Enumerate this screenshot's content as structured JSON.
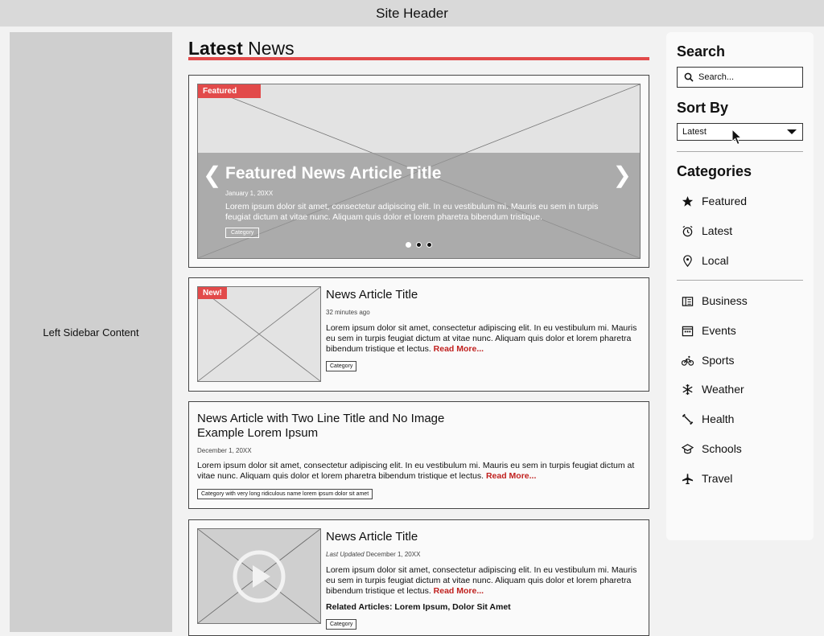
{
  "header": {
    "title": "Site Header"
  },
  "left_sidebar": {
    "text": "Left Sidebar Content"
  },
  "main": {
    "title_bold": "Latest",
    "title_light": "News"
  },
  "featured": {
    "badge": "Featured",
    "title": "Featured News Article Title",
    "date": "January 1, 20XX",
    "text": "Lorem ipsum dolor sit amet, consectetur adipiscing elit. In eu vestibulum mi. Mauris eu sem in turpis feugiat dictum at vitae nunc. Aliquam quis dolor et lorem pharetra bibendum tristique.",
    "category": "Category",
    "prev_icon": "chevron-left-icon",
    "next_icon": "chevron-right-icon",
    "slides": 3,
    "active_slide": 1
  },
  "articles": [
    {
      "badge": "New!",
      "title": "News Article Title",
      "meta": "32 minutes ago",
      "text": "Lorem ipsum dolor sit amet, consectetur adipiscing elit. In eu vestibulum mi. Mauris eu sem in turpis feugiat dictum at vitae nunc. Aliquam quis dolor et lorem pharetra bibendum tristique et lectus.",
      "read_more": "Read More...",
      "category": "Category"
    },
    {
      "title_line1": "News Article with Two Line Title and No Image",
      "title_line2": "Example Lorem Ipsum",
      "meta": "December 1, 20XX",
      "text": "Lorem ipsum dolor sit amet, consectetur adipiscing elit. In eu vestibulum mi. Mauris eu sem in turpis feugiat dictum at vitae nunc. Aliquam quis dolor et lorem pharetra bibendum tristique et lectus.",
      "read_more": "Read More...",
      "category": "Category with very long ridiculous name lorem ipsum dolor sit amet"
    },
    {
      "title": "News Article Title",
      "meta_prefix": "Last Updated",
      "meta": "December 1, 20XX",
      "text": "Lorem ipsum dolor sit amet, consectetur adipiscing elit. In eu vestibulum mi. Mauris eu sem in turpis feugiat dictum at vitae nunc. Aliquam quis dolor et lorem pharetra bibendum tristique et lectus.",
      "read_more": "Read More...",
      "related": "Related Articles: Lorem Ipsum, Dolor Sit Amet",
      "category": "Category",
      "media_icon": "play-icon"
    }
  ],
  "right_panel": {
    "search_heading": "Search",
    "search_placeholder": "Search...",
    "search_icon": "search-icon",
    "sort_heading": "Sort By",
    "sort_value": "Latest",
    "categories_heading": "Categories",
    "categories_group1": [
      {
        "label": "Featured",
        "icon": "star-icon"
      },
      {
        "label": "Latest",
        "icon": "alarm-clock-icon"
      },
      {
        "label": "Local",
        "icon": "location-pin-icon"
      }
    ],
    "categories_group2": [
      {
        "label": "Business",
        "icon": "building-icon"
      },
      {
        "label": "Events",
        "icon": "calendar-icon"
      },
      {
        "label": "Sports",
        "icon": "bicycle-icon"
      },
      {
        "label": "Weather",
        "icon": "snowflake-icon"
      },
      {
        "label": "Health",
        "icon": "dumbbell-icon"
      },
      {
        "label": "Schools",
        "icon": "graduation-cap-icon"
      },
      {
        "label": "Travel",
        "icon": "airplane-icon"
      }
    ]
  },
  "colors": {
    "accent": "#e24a4a",
    "read_more": "#c0201e"
  }
}
